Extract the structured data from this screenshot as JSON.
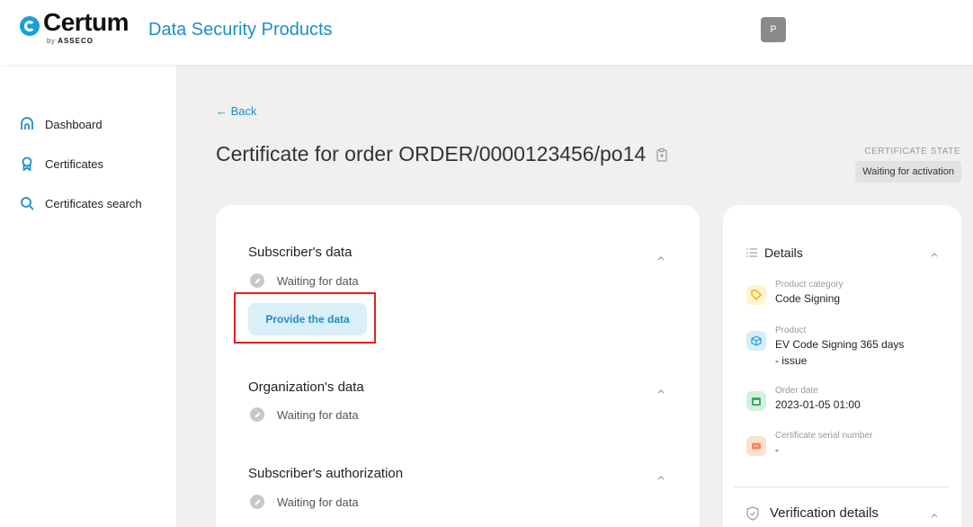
{
  "header": {
    "brand_name": "Certum",
    "brand_by": "by",
    "brand_parent": "ASSECO",
    "product_title": "Data Security Products",
    "avatar_initial": "P"
  },
  "sidebar": {
    "items": [
      {
        "label": "Dashboard",
        "icon": "home-icon"
      },
      {
        "label": "Certificates",
        "icon": "badge-icon"
      },
      {
        "label": "Certificates search",
        "icon": "search-icon"
      }
    ]
  },
  "main": {
    "back_label": "← Back",
    "title": "Certificate for order ORDER/0000123456/po14",
    "state_label": "CERTIFICATE STATE",
    "state_value": "Waiting for activation",
    "sections": [
      {
        "title": "Subscriber's data",
        "status": "Waiting for data",
        "action_label": "Provide the data"
      },
      {
        "title": "Organization's data",
        "status": "Waiting for data"
      },
      {
        "title": "Subscriber's authorization",
        "status": "Waiting for data"
      }
    ]
  },
  "details": {
    "title": "Details",
    "items": [
      {
        "label": "Product category",
        "value": "Code Signing",
        "icon": "tag-icon",
        "color": "#f7d24a",
        "bg": "#fdf3cf"
      },
      {
        "label": "Product",
        "value": "EV Code Signing 365 days - issue",
        "icon": "cube-icon",
        "color": "#1aa0d8",
        "bg": "#d6eef9"
      },
      {
        "label": "Order date",
        "value": "2023-01-05 01:00",
        "icon": "calendar-icon",
        "color": "#2fb35a",
        "bg": "#d4f0dc"
      },
      {
        "label": "Certificate serial number",
        "value": "-",
        "icon": "serial-icon",
        "color": "#f08a5d",
        "bg": "#fde0d3"
      }
    ],
    "verification_title": "Verification details"
  },
  "colors": {
    "accent": "#1a8fc9",
    "highlight": "#e02020"
  }
}
